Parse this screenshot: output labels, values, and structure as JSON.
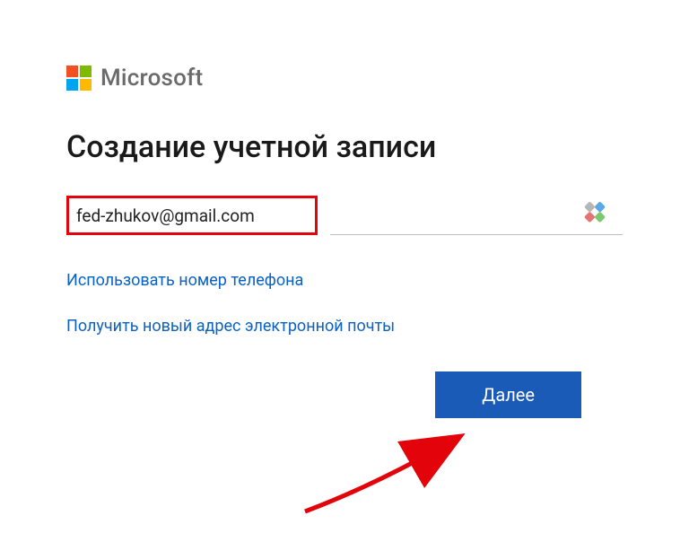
{
  "brand": {
    "name": "Microsoft"
  },
  "heading": "Создание учетной записи",
  "email": {
    "value": "fed-zhukov@gmail.com"
  },
  "links": {
    "use_phone": "Использовать номер телефона",
    "get_new_email": "Получить новый адрес электронной почты"
  },
  "buttons": {
    "next": "Далее"
  }
}
